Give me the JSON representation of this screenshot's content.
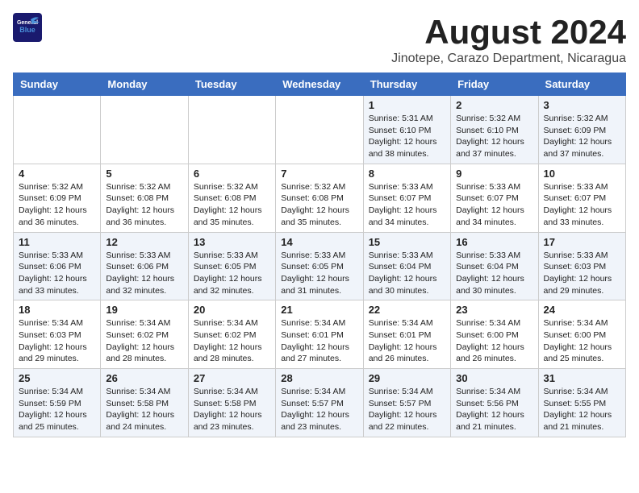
{
  "logo": {
    "text_general": "General",
    "text_blue": "Blue"
  },
  "title": "August 2024",
  "subtitle": "Jinotepe, Carazo Department, Nicaragua",
  "headers": [
    "Sunday",
    "Monday",
    "Tuesday",
    "Wednesday",
    "Thursday",
    "Friday",
    "Saturday"
  ],
  "weeks": [
    [
      {
        "day": "",
        "info": ""
      },
      {
        "day": "",
        "info": ""
      },
      {
        "day": "",
        "info": ""
      },
      {
        "day": "",
        "info": ""
      },
      {
        "day": "1",
        "info": "Sunrise: 5:31 AM\nSunset: 6:10 PM\nDaylight: 12 hours\nand 38 minutes."
      },
      {
        "day": "2",
        "info": "Sunrise: 5:32 AM\nSunset: 6:10 PM\nDaylight: 12 hours\nand 37 minutes."
      },
      {
        "day": "3",
        "info": "Sunrise: 5:32 AM\nSunset: 6:09 PM\nDaylight: 12 hours\nand 37 minutes."
      }
    ],
    [
      {
        "day": "4",
        "info": "Sunrise: 5:32 AM\nSunset: 6:09 PM\nDaylight: 12 hours\nand 36 minutes."
      },
      {
        "day": "5",
        "info": "Sunrise: 5:32 AM\nSunset: 6:08 PM\nDaylight: 12 hours\nand 36 minutes."
      },
      {
        "day": "6",
        "info": "Sunrise: 5:32 AM\nSunset: 6:08 PM\nDaylight: 12 hours\nand 35 minutes."
      },
      {
        "day": "7",
        "info": "Sunrise: 5:32 AM\nSunset: 6:08 PM\nDaylight: 12 hours\nand 35 minutes."
      },
      {
        "day": "8",
        "info": "Sunrise: 5:33 AM\nSunset: 6:07 PM\nDaylight: 12 hours\nand 34 minutes."
      },
      {
        "day": "9",
        "info": "Sunrise: 5:33 AM\nSunset: 6:07 PM\nDaylight: 12 hours\nand 34 minutes."
      },
      {
        "day": "10",
        "info": "Sunrise: 5:33 AM\nSunset: 6:07 PM\nDaylight: 12 hours\nand 33 minutes."
      }
    ],
    [
      {
        "day": "11",
        "info": "Sunrise: 5:33 AM\nSunset: 6:06 PM\nDaylight: 12 hours\nand 33 minutes."
      },
      {
        "day": "12",
        "info": "Sunrise: 5:33 AM\nSunset: 6:06 PM\nDaylight: 12 hours\nand 32 minutes."
      },
      {
        "day": "13",
        "info": "Sunrise: 5:33 AM\nSunset: 6:05 PM\nDaylight: 12 hours\nand 32 minutes."
      },
      {
        "day": "14",
        "info": "Sunrise: 5:33 AM\nSunset: 6:05 PM\nDaylight: 12 hours\nand 31 minutes."
      },
      {
        "day": "15",
        "info": "Sunrise: 5:33 AM\nSunset: 6:04 PM\nDaylight: 12 hours\nand 30 minutes."
      },
      {
        "day": "16",
        "info": "Sunrise: 5:33 AM\nSunset: 6:04 PM\nDaylight: 12 hours\nand 30 minutes."
      },
      {
        "day": "17",
        "info": "Sunrise: 5:33 AM\nSunset: 6:03 PM\nDaylight: 12 hours\nand 29 minutes."
      }
    ],
    [
      {
        "day": "18",
        "info": "Sunrise: 5:34 AM\nSunset: 6:03 PM\nDaylight: 12 hours\nand 29 minutes."
      },
      {
        "day": "19",
        "info": "Sunrise: 5:34 AM\nSunset: 6:02 PM\nDaylight: 12 hours\nand 28 minutes."
      },
      {
        "day": "20",
        "info": "Sunrise: 5:34 AM\nSunset: 6:02 PM\nDaylight: 12 hours\nand 28 minutes."
      },
      {
        "day": "21",
        "info": "Sunrise: 5:34 AM\nSunset: 6:01 PM\nDaylight: 12 hours\nand 27 minutes."
      },
      {
        "day": "22",
        "info": "Sunrise: 5:34 AM\nSunset: 6:01 PM\nDaylight: 12 hours\nand 26 minutes."
      },
      {
        "day": "23",
        "info": "Sunrise: 5:34 AM\nSunset: 6:00 PM\nDaylight: 12 hours\nand 26 minutes."
      },
      {
        "day": "24",
        "info": "Sunrise: 5:34 AM\nSunset: 6:00 PM\nDaylight: 12 hours\nand 25 minutes."
      }
    ],
    [
      {
        "day": "25",
        "info": "Sunrise: 5:34 AM\nSunset: 5:59 PM\nDaylight: 12 hours\nand 25 minutes."
      },
      {
        "day": "26",
        "info": "Sunrise: 5:34 AM\nSunset: 5:58 PM\nDaylight: 12 hours\nand 24 minutes."
      },
      {
        "day": "27",
        "info": "Sunrise: 5:34 AM\nSunset: 5:58 PM\nDaylight: 12 hours\nand 23 minutes."
      },
      {
        "day": "28",
        "info": "Sunrise: 5:34 AM\nSunset: 5:57 PM\nDaylight: 12 hours\nand 23 minutes."
      },
      {
        "day": "29",
        "info": "Sunrise: 5:34 AM\nSunset: 5:57 PM\nDaylight: 12 hours\nand 22 minutes."
      },
      {
        "day": "30",
        "info": "Sunrise: 5:34 AM\nSunset: 5:56 PM\nDaylight: 12 hours\nand 21 minutes."
      },
      {
        "day": "31",
        "info": "Sunrise: 5:34 AM\nSunset: 5:55 PM\nDaylight: 12 hours\nand 21 minutes."
      }
    ]
  ]
}
